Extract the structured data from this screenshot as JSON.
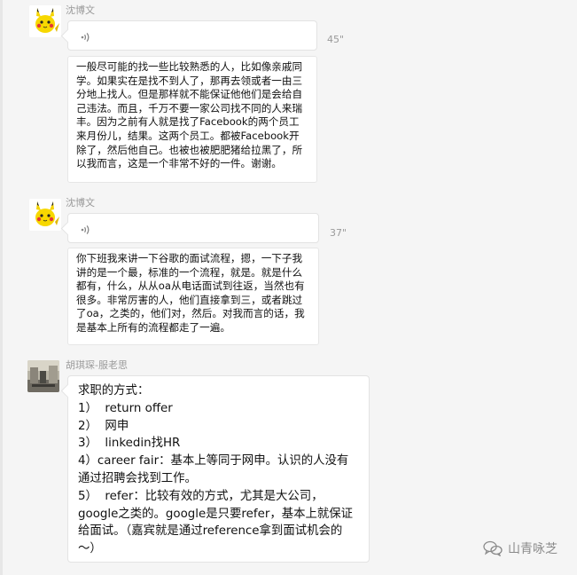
{
  "messages": [
    {
      "sender": "沈博文",
      "duration": "45\"",
      "transcript": "一般尽可能的找一些比较熟悉的人，比如像亲戚同\n学。如果实在是找不到人了，那再去领或者一由三\n分地上找人。但是那样就不能保证他他们是会给自\n己违法。而且，千万不要一家公司找不同的人来瑞\n丰。因为之前有人就是找了Facebook的两个员工\n来月份儿，结果。这两个员工。都被Facebook开\n除了，然后他自己。也被也被肥肥猪给拉黑了，所\n以我而言，这是一个非常不好的一件。谢谢。"
    },
    {
      "sender": "沈博文",
      "duration": "37\"",
      "transcript": "你下班我来讲一下谷歌的面试流程，摁，一下子我\n讲的是一个最，标准的一个流程，就是。就是什么\n都有，什么，从从oa从电话面试到往返，当然也有\n很多。非常厉害的人，他们直接拿到三，或者跳过\n了oa，之类的，他们对，然后。对我而言的话，我\n是基本上所有的流程都走了一遍。"
    },
    {
      "sender": "胡琪琛-服老思",
      "text": "求职的方式：\n1）  return offer\n2）  网申\n3）  linkedin找HR\n4）career fair：基本上等同于网申。认识的人没有\n通过招聘会找到工作。\n5）  refer：比较有效的方式，尤其是大公司，\ngoogle之类的。google是只要refer，基本上就保证\n给面试。（嘉宾就是通过reference拿到面试机会的\n～）"
    }
  ],
  "watermark": "山青咏芝",
  "colors": {
    "background": "#f5f5f5",
    "bubble": "#ffffff",
    "meta_text": "#9a9a9a"
  }
}
